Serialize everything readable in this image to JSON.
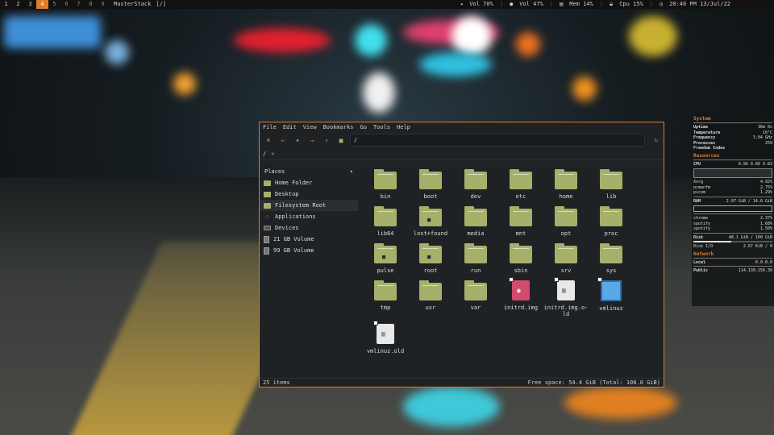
{
  "topbar": {
    "workspaces": [
      "1",
      "2",
      "3",
      "4",
      "5",
      "6",
      "7",
      "8",
      "9"
    ],
    "active_workspace": "4",
    "layout": "MasterStack",
    "window_title": "[/]",
    "status": {
      "vol_out": "Vol 70%",
      "vol_mic": "Vol 47%",
      "mem": "Mem 14%",
      "cpu": "Cpu 15%",
      "datetime": "20:46 PM 13/Jul/22"
    }
  },
  "filemanager": {
    "menu": [
      "File",
      "Edit",
      "View",
      "Bookmarks",
      "Go",
      "Tools",
      "Help"
    ],
    "path": "/",
    "tab_label": "/",
    "sidebar": {
      "header": "Places",
      "items": [
        {
          "label": "Home Folder",
          "icon": "folder-icon"
        },
        {
          "label": "Desktop",
          "icon": "folder-icon"
        },
        {
          "label": "Filesystem Root",
          "icon": "folder-icon",
          "active": true
        },
        {
          "label": "Applications",
          "icon": "apps-icon"
        },
        {
          "label": "Devices",
          "icon": "devices-icon"
        },
        {
          "label": "21 GB Volume",
          "icon": "drive-icon"
        },
        {
          "label": "99 GB Volume",
          "icon": "drive-icon"
        }
      ]
    },
    "items": [
      {
        "name": "bin",
        "type": "folder"
      },
      {
        "name": "boot",
        "type": "folder"
      },
      {
        "name": "dev",
        "type": "folder"
      },
      {
        "name": "etc",
        "type": "folder"
      },
      {
        "name": "home",
        "type": "folder"
      },
      {
        "name": "lib",
        "type": "folder"
      },
      {
        "name": "lib64",
        "type": "folder"
      },
      {
        "name": "lost+found",
        "type": "locked"
      },
      {
        "name": "media",
        "type": "folder"
      },
      {
        "name": "mnt",
        "type": "folder"
      },
      {
        "name": "opt",
        "type": "folder"
      },
      {
        "name": "proc",
        "type": "folder"
      },
      {
        "name": "pulse",
        "type": "locked"
      },
      {
        "name": "root",
        "type": "locked"
      },
      {
        "name": "run",
        "type": "folder"
      },
      {
        "name": "sbin",
        "type": "folder"
      },
      {
        "name": "srv",
        "type": "folder"
      },
      {
        "name": "sys",
        "type": "folder"
      },
      {
        "name": "tmp",
        "type": "folder"
      },
      {
        "name": "usr",
        "type": "folder"
      },
      {
        "name": "var",
        "type": "folder"
      },
      {
        "name": "initrd.img",
        "type": "image-link"
      },
      {
        "name": "initrd.img.o-ld",
        "type": "file-link"
      },
      {
        "name": "vmlinuz",
        "type": "windows-link"
      },
      {
        "name": "vmlinuz.old",
        "type": "file-link"
      }
    ],
    "status_left": "25 items",
    "status_right": "Free space: 54.4 GiB (Total: 108.0 GiB)"
  },
  "conky": {
    "system_title": "System",
    "system": [
      {
        "k": "Uptime",
        "v": "36m 0s"
      },
      {
        "k": "Temperature",
        "v": "16°C"
      },
      {
        "k": "Frequency",
        "v": "3.04 GHz"
      },
      {
        "k": "Processes",
        "v": "259"
      },
      {
        "k": "Freedom Index",
        "v": ""
      }
    ],
    "resources_title": "Resources",
    "cpu_label": "CPU",
    "cpu_load": "0.96 0.89 0.83",
    "cpu_procs": [
      {
        "k": "Xorg",
        "v": "4.92%"
      },
      {
        "k": "pcmanfm",
        "v": "2.75%"
      },
      {
        "k": "picom",
        "v": "1.29%"
      }
    ],
    "ram_label": "RAM",
    "ram_value": "2.07 GiB / 14.6 GiB",
    "ram_procs": [
      {
        "k": "chrome",
        "v": "2.37%"
      },
      {
        "k": "spotify",
        "v": "1.68%"
      },
      {
        "k": "spotify",
        "v": "1.50%"
      }
    ],
    "disk_label": "Disk",
    "disk_value": "48.1 GiB / 100 GiB",
    "disk_fraction": 0.48,
    "diskio_label": "Disk I/O",
    "diskio_value": "2.67 KiB / 0",
    "network_title": "Network",
    "local_label": "Local",
    "local_value": "0.0.0.0",
    "public_label": "Public",
    "public_value": "114.130.156.30"
  }
}
